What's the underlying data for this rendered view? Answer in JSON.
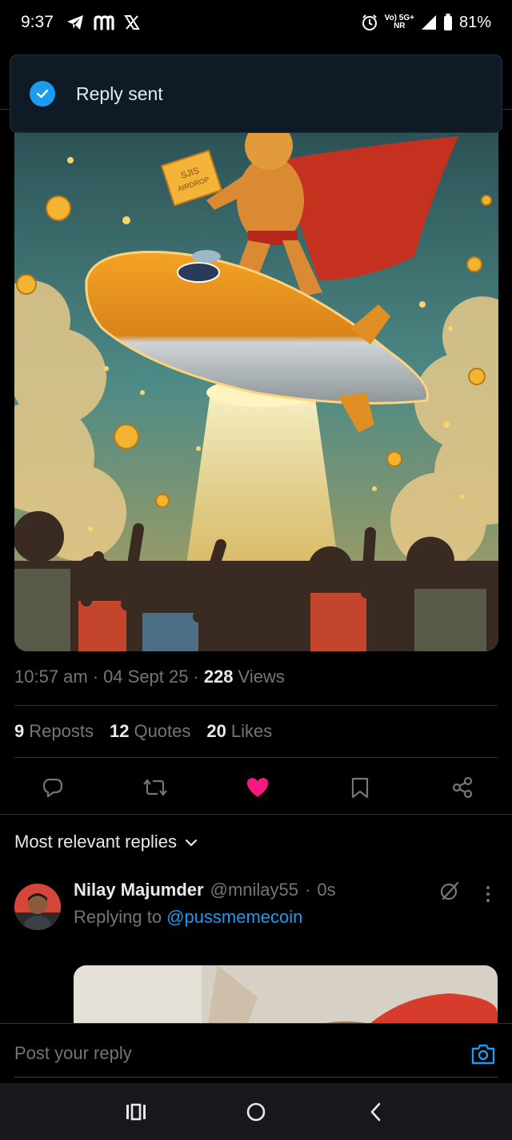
{
  "status_bar": {
    "time": "9:37",
    "left_icons": [
      "telegram-icon",
      "m-app-icon",
      "x-icon"
    ],
    "network_top": "Vo) 5G+",
    "network_bottom": "NR",
    "battery": "81%"
  },
  "toast": {
    "text": "Reply sent"
  },
  "post": {
    "time": "10:57 am",
    "date": "04 Sept 25",
    "views_count": "228",
    "views_label": "Views",
    "reposts_count": "9",
    "reposts_label": "Reposts",
    "quotes_count": "12",
    "quotes_label": "Quotes",
    "likes_count": "20",
    "likes_label": "Likes",
    "liked": true
  },
  "colors": {
    "accent": "#1d9bf0",
    "like": "#f91880",
    "muted": "#71767b",
    "text": "#e7e9ea",
    "divider": "#2f3336"
  },
  "replies": {
    "sort_label": "Most relevant replies",
    "items": [
      {
        "name": "Nilay Majumder",
        "handle": "@mnilay55",
        "time": "0s",
        "replying_label": "Replying to",
        "replying_to": "@pussmemecoin"
      }
    ]
  },
  "composer": {
    "placeholder": "Post your reply"
  }
}
